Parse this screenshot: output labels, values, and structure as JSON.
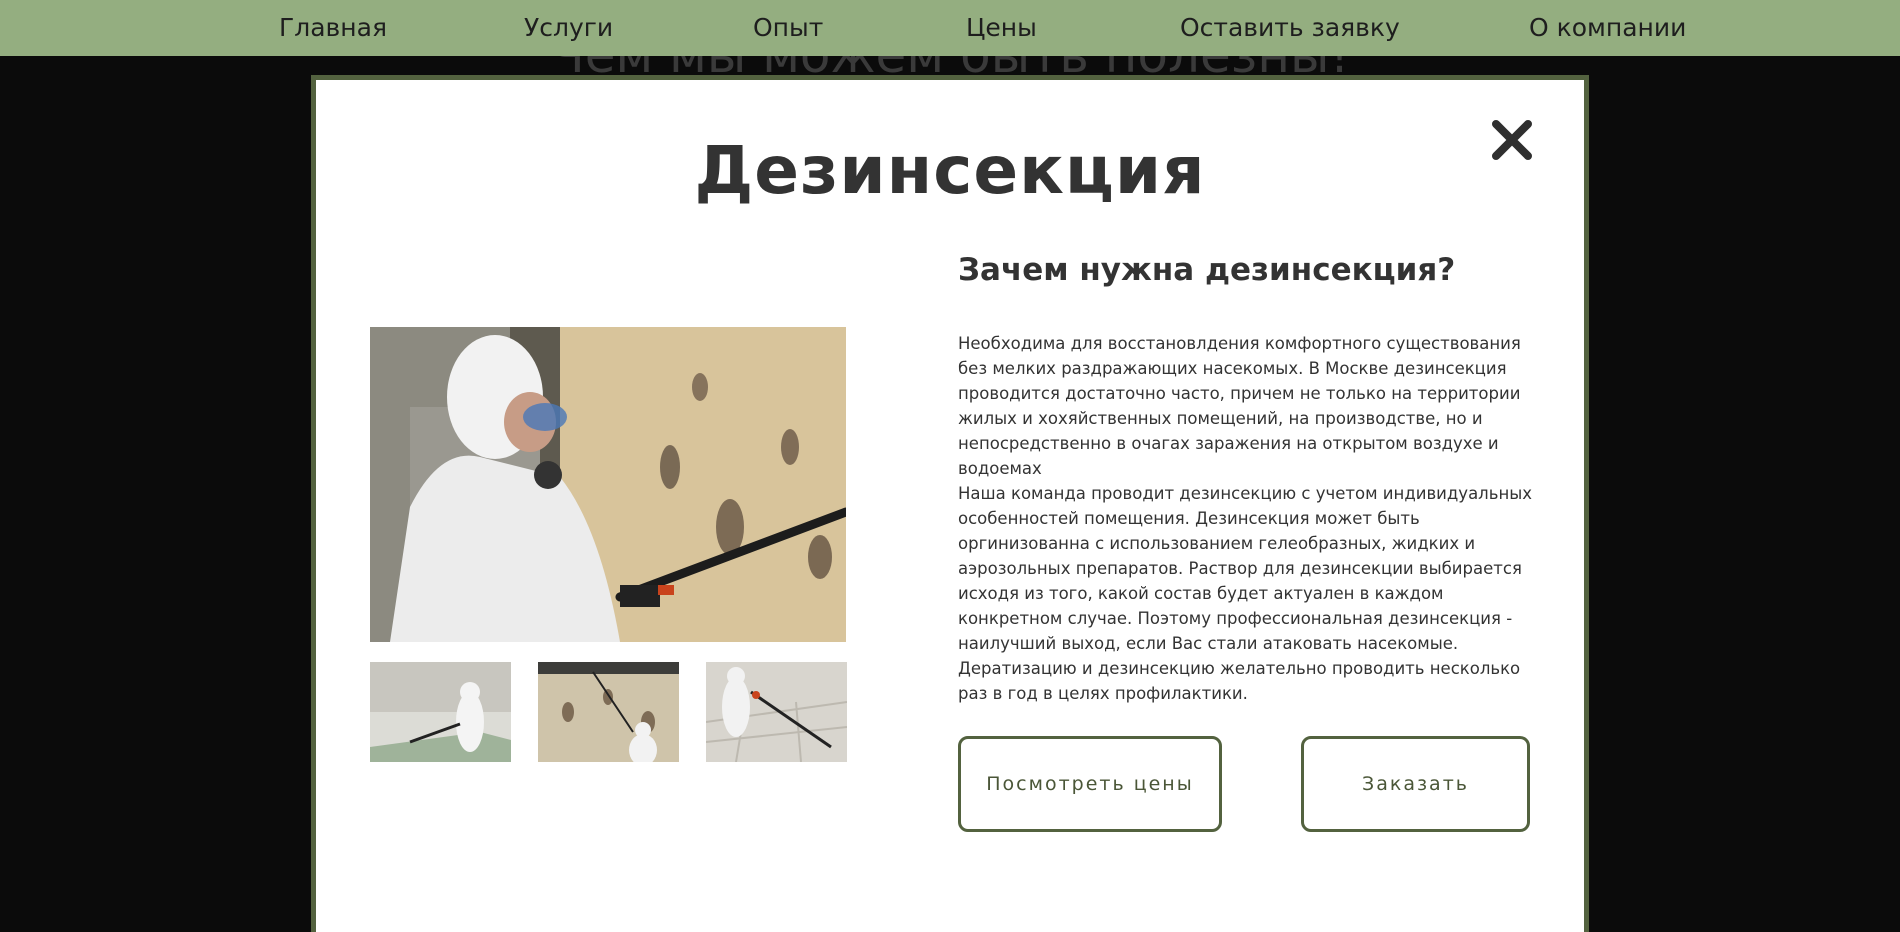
{
  "nav": {
    "items": [
      {
        "label": "Главная"
      },
      {
        "label": "Услуги"
      },
      {
        "label": "Опыт"
      },
      {
        "label": "Цены"
      },
      {
        "label": "Оставить заявку"
      },
      {
        "label": "О компании"
      }
    ]
  },
  "background": {
    "heading": "Чем мы можем быть полезны!"
  },
  "modal": {
    "title": "Дезинсекция",
    "close_icon": "close-icon",
    "subtitle": "Зачем нужна дезинсекция?",
    "paragraphs": [
      "Необходима для восстановлдения комфортного существования без мелких раздражающих насекомых. В Москве дезинсекция проводится достаточно часто, причем не только на территории жилых и хохяйственных помещений, на производстве, но и непосредственно в очагах заражения на открытом воздухе и водоемах",
      "Наша команда проводит дезинсекцию с учетом индивидуальных особенностей помещения. Дезинсекция может быть оргинизованна с использованием гелеобразных, жидких и аэрозольных препаратов. Раствор для дезинсекции выбирается исходя из того, какой состав будет актуален в каждом конкретном случае. Поэтому профессиональная дезинсекция - наилучший выход, если Вас стали атаковать насекомые.",
      "Дератизацию и дезинсекцию желательно проводить несколько раз в год в целях профилактики."
    ],
    "buttons": {
      "prices": "Посмотреть цены",
      "order": "Заказать"
    }
  },
  "colors": {
    "nav_bg": "#94ae80",
    "accent": "#53623f",
    "text": "#333333"
  }
}
